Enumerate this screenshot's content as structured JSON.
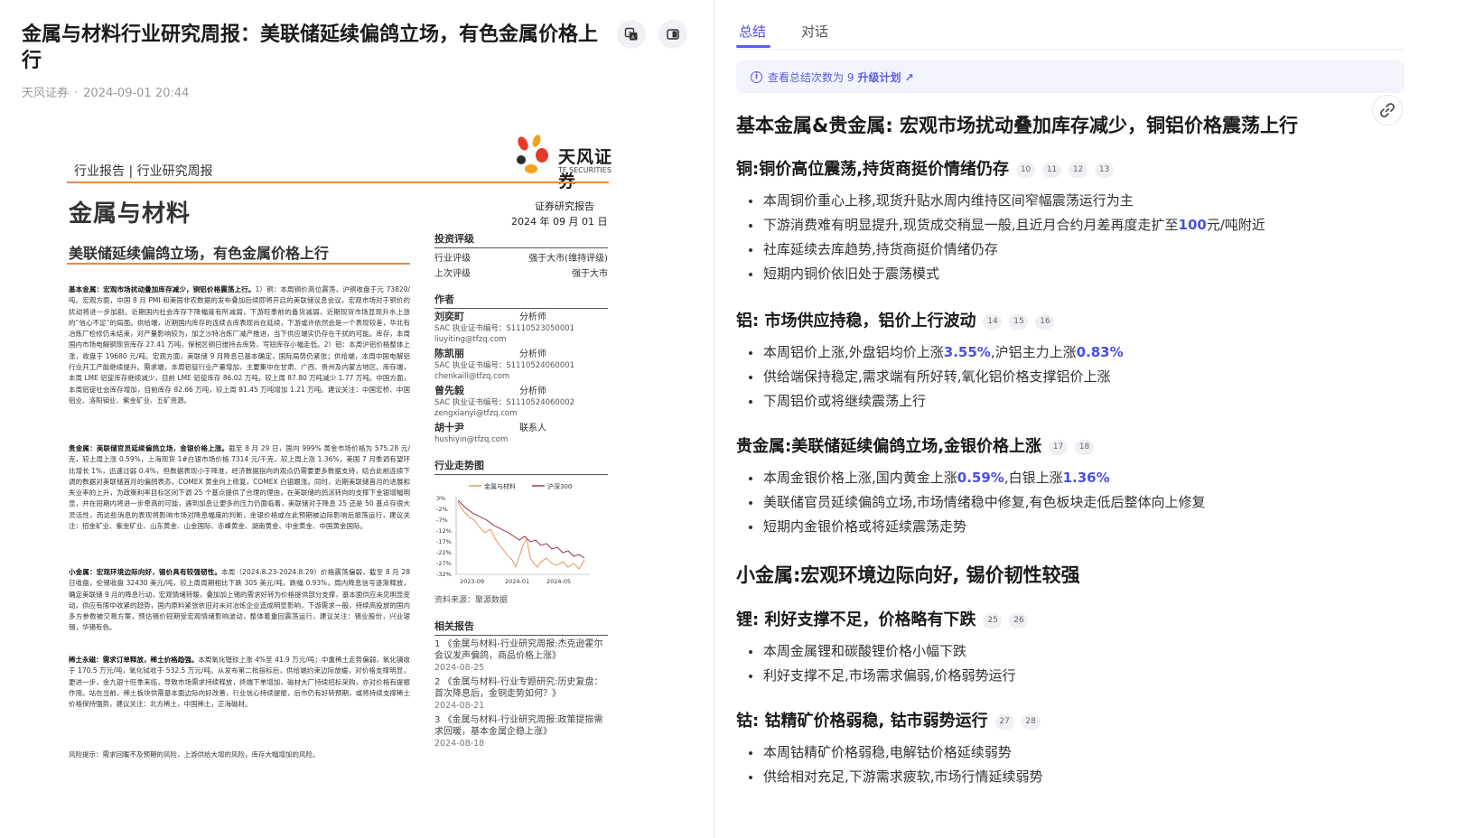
{
  "article": {
    "title": "金属与材料行业研究周报：美联储延续偏鸽立场，有色金属价格上行",
    "source": "天风证券",
    "date": "2024-09-01 20:44"
  },
  "report": {
    "logo_text": "天风证券",
    "logo_sub": "TF SECURITIES",
    "category": "行业报告 | 行业研究周报",
    "big_title": "金属与材料",
    "subtitle": "美联储延续偏鸽立场，有色金属价格上行",
    "report_tag": "证券研究报告",
    "report_date": "2024 年 09 月 01 日",
    "rating_header": "投资评级",
    "rating_industry_label": "行业评级",
    "rating_industry_value": "强于大市(维持评级)",
    "rating_prev_label": "上次评级",
    "rating_prev_value": "强于大市",
    "authors_header": "作者",
    "authors": [
      {
        "name": "刘奕町",
        "role": "分析师",
        "sac": "SAC 执业证书编号：S1110523050001",
        "email": "liuyiting@tfzq.com"
      },
      {
        "name": "陈凯丽",
        "role": "分析师",
        "sac": "SAC 执业证书编号：S1110524060001",
        "email": "chenkaili@tfzq.com"
      },
      {
        "name": "曾先毅",
        "role": "分析师",
        "sac": "SAC 执业证书编号：S1110524060002",
        "email": "zengxianyi@tfzq.com"
      },
      {
        "name": "胡十尹",
        "role": "联系人",
        "sac": "",
        "email": "hushiyin@tfzq.com"
      }
    ],
    "trend_header": "行业走势图",
    "trend_legend_a": "金属与材料",
    "trend_legend_b": "沪深300",
    "trend_yticks": [
      "3%",
      "-2%",
      "-7%",
      "-12%",
      "-17%",
      "-22%",
      "-27%",
      "-32%"
    ],
    "trend_xticks": [
      "2023-09",
      "2024-01",
      "2024-05"
    ],
    "trend_source": "资料来源：聚源数据",
    "related_header": "相关报告",
    "related": [
      {
        "text": "1 《金属与材料-行业研究周报:杰克逊霍尔会议发声偏鸽，商品价格上涨》",
        "date": "2024-08-25"
      },
      {
        "text": "2 《金属与材料-行业专题研究:历史复盘：首次降息后，金铜走势如何？》",
        "date": "2024-08-21"
      },
      {
        "text": "3 《金属与材料-行业研究周报:政策提振需求回暖，基本金属企稳上涨》",
        "date": "2024-08-18"
      }
    ],
    "body": {
      "p1_lead": "基本金属：宏观市场扰动叠加库存减少，铜铝价格震荡上行。",
      "p1": "1）铜：本周铜价高位震荡，沪铜收盘于元 73820/吨。宏观方面，中国 8 月 PMI 和美国非农数据的发布叠加后续即将开启的美联储议息会议，宏观市场对于铜价的扰动将进一步加剧。近期国内社会库存下降幅度有所减弱，下游旺季前的备货减弱，近期现货市场显现升水上涨的“信心不足”的局面。供给端，近期国内库存的连续去库表现尚在延续，下游或许依然会是一个表现较差，华北有冶炼厂检修仍未结束，对产量影响较为，加之沙特冶炼厂减产推进，当下供应端实仍存在干扰的可能。库存，本周国内市场电解铜现货库存 27.41 万吨，保税区铜日维持去库势，写短库存小幅走低。2）铝：本周沪铝价格整体上涨，收盘于 19680 元/吨。宏观方面，美联储 9 月降息已基本确定，国际局势仍紧张；供给端，本周中国电解铝行业开工产能继续提升。需求端，本周铝锭行业产量增加，主要集中在甘肃、广西、贵州及内蒙古地区。库存端，本周 LME 铝锭库存继续减少，目前 LME 铝锭库存 86.02 万吨，较上周 87.80 万吨减少 1.77 万吨。中国方面，本周铝锭社会库存增加，目前库存 82.66 万吨，较上周 81.45 万吨增加 1.21 万吨。建议关注：中国宏桥、中国铝业、洛阳钼业、紫金矿业、五矿资源。",
      "p2_lead": "贵金属：美联储官员延续偏鸽立场，金银价格上涨。",
      "p2": "截至 8 月 29 日，国内 999% 黄金市场价格为 575.28 元/克，较上周上涨 0.59%，上海现货 1#白银市场价格 7314 元/千克，较上周上涨 1.36%，美国 7 月季调有望环比增长 1%，迅速过弱 0.4%，但数据表现小于降准，经济数据指向的观点仍需要更多数据支持，结合此前连续下调的数据对美联储首月的偏鸽表态，COMEX 黄金向上修复，COMEX 白银跟涨。同时，近期美联储首月的进展和失业率的上升，为政策利率目标区间下调 25 个基点提供了合理的理由，在美联储的鸽派转向的支撑下金银增幅明显，并在短期内将进一步牵高的可能，遇到加息让更多的压力仍面临着，美联储对于降息 25 还是 50 基点存很大灵活性，而这些消息的表现将影响市场对降息幅度的判断，金银价格或在此预期被边际影响后振荡运行，建议关注：招金矿业、紫金矿业、山东黄金、山金国际、赤峰黄金、湖南黄金、中金黄金、中国黄金国际。",
      "p3_lead": "小金属：宏观环境边际向好，锡价具有较强韧性。",
      "p3": "本周（2024.8.23-2024.8.29）价格震荡偏弱，截至 8 月 28 日收盘，伦锡收盘 32430 美元/吨，较上周周期相比下跌 305 美元/吨，跌幅 0.93%，周内降息信号逐渐释放，确定美联储 9 月的降息行动，宏观情绪转暖，叠加加上锡的需求好转为价格提供部分支撑，基本面供应未见明显变动，供应有限中收紧的趋势，国内原料紧张依旧对未对冶炼企业造成明显影响，下游需求一般，持续高投放的国内多方参数被交易方案，预估锡价短期受宏观情绪影响波动，整体着重回震荡运行，建议关注：锡业股份，兴业银锡，华锡有色。",
      "p4_lead": "稀土永磁：需求订单释放，稀土价格趋强。",
      "p4": "本周氧化镨钕上涨 4%至 41.9 万元/吨；中重稀土走势偏弱，氧化镝收于 170.5 万元/吨，氧化铽收于 532.5 万元/吨。从发布第二批指标后，供给端约束边际放缓，对价格支撑明显，更进一步，金九银十旺季来临，导致市场需求持续释放，终端下单增加，磁材大厂持续招标采购，亦对价格有提振作用。站在当前，稀土板块供需基本面边际向好改善，行业信心持续提振，后市仍有好转预期，或将持续支撑稀土价格保持强势，建议关注：北方稀土，中国稀土，正海磁材。",
      "risk": "风险提示：需求回暖不及预期的风险，上游供给大增的风险，库存大幅增加的风险。"
    }
  },
  "panel": {
    "tabs": [
      "总结",
      "对话"
    ],
    "notice_prefix": "查看总结次数为 9",
    "notice_plan": "升级计划 ↗",
    "sections": [
      {
        "level": 1,
        "title": "基本金属&贵金属: 宏观市场扰动叠加库存减少，铜铝价格震荡上行",
        "cites": []
      },
      {
        "level": 2,
        "title": "铜:铜价高位震荡,持货商挺价情绪仍存",
        "cites": [
          "10",
          "11",
          "12",
          "13"
        ],
        "items": [
          {
            "text": "本周铜价重心上移,现货升贴水周内维持区间窄幅震荡运行为主"
          },
          {
            "pre": "下游消费难有明显提升,现货成交稍显一般,且近月合约月差再度走扩至",
            "hl": "100",
            "post": "元/吨附近"
          },
          {
            "text": "社库延续去库趋势,持货商挺价情绪仍存"
          },
          {
            "text": "短期内铜价依旧处于震荡模式"
          }
        ]
      },
      {
        "level": 2,
        "title": "铝: 市场供应持稳，铝价上行波动",
        "cites": [
          "14",
          "15",
          "16"
        ],
        "items": [
          {
            "pre": "本周铝价上涨,外盘铝均价上涨",
            "hl": "3.55%",
            "mid": ",沪铝主力上涨",
            "hl2": "0.83%"
          },
          {
            "text": "供给端保持稳定,需求端有所好转,氧化铝价格支撑铝价上涨"
          },
          {
            "text": "下周铝价或将继续震荡上行"
          }
        ]
      },
      {
        "level": 2,
        "title": "贵金属:美联储延续偏鸽立场,金银价格上涨",
        "cites": [
          "17",
          "18"
        ],
        "items": [
          {
            "pre": "本周金银价格上涨,国内黄金上涨",
            "hl": "0.59%",
            "mid": ",白银上涨",
            "hl2": "1.36%"
          },
          {
            "text": "美联储官员延续偏鸽立场,市场情绪稳中修复,有色板块走低后整体向上修复"
          },
          {
            "text": "短期内金银价格或将延续震荡走势"
          }
        ]
      },
      {
        "level": 1,
        "title": "小金属:宏观环境边际向好, 锡价韧性较强",
        "cites": []
      },
      {
        "level": 2,
        "title": "锂: 利好支撑不足，价格略有下跌",
        "cites": [
          "25",
          "26"
        ],
        "items": [
          {
            "text": "本周金属锂和碳酸锂价格小幅下跌"
          },
          {
            "text": "利好支撑不足,市场需求偏弱,价格弱势运行"
          }
        ]
      },
      {
        "level": 2,
        "title": "钴: 钴精矿价格弱稳, 钴市弱势运行",
        "cites": [
          "27",
          "28"
        ],
        "items": [
          {
            "text": "本周钴精矿价格弱稳,电解钴价格延续弱势"
          },
          {
            "text": "供给相对充足,下游需求疲软,市场行情延续弱势"
          }
        ]
      }
    ]
  }
}
